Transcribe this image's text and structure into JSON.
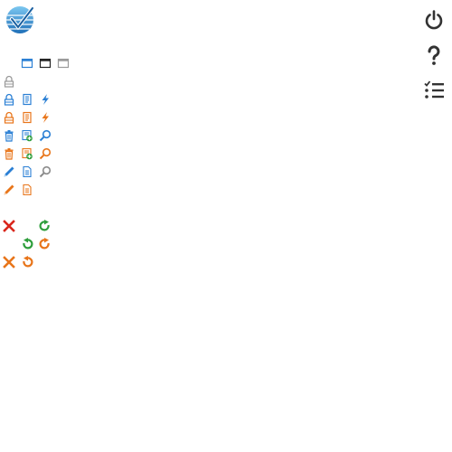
{
  "app": {
    "logo": "app-logo-checkmark-globe"
  },
  "colors": {
    "blue": "#2a7fd4",
    "orange": "#e8751a",
    "gray": "#9a9a9a",
    "red": "#d9261c",
    "green": "#2e9e3c",
    "dark": "#333333"
  },
  "toolbar_right": [
    "power-icon",
    "help-icon",
    "checklist-icon"
  ],
  "icon_sheet": [
    [
      "window-blue-icon",
      "window-dark-icon",
      "window-gray-icon"
    ],
    [
      "lock-gray-icon"
    ],
    [
      "lock-blue-icon",
      "document-stack-blue-icon",
      "lightning-blue-icon"
    ],
    [
      "lock-orange-icon",
      "document-stack-orange-icon",
      "lightning-orange-icon"
    ],
    [
      "trash-blue-icon",
      "add-record-green-icon",
      "search-blue-icon"
    ],
    [
      "trash-orange-icon",
      "add-record-orange-icon",
      "search-orange-icon"
    ],
    [
      "pencil-blue-icon",
      "document-blue-icon",
      "search-gray-icon"
    ],
    [
      "pencil-orange-icon",
      "document-orange-icon"
    ],
    [
      "close-red-icon",
      "redo-green-icon"
    ],
    [
      "undo-green-icon",
      "redo-orange-icon"
    ],
    [
      "close-orange-icon",
      "undo-orange-icon"
    ]
  ]
}
